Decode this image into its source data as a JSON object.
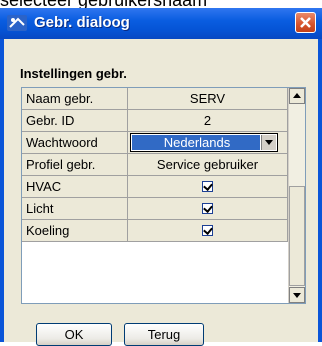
{
  "top_caption": "selecteer gebruikersnaam",
  "window": {
    "title": "Gebr. dialoog"
  },
  "section_title": "Instellingen gebr.",
  "rows": [
    {
      "label": "Naam gebr.",
      "value": "SERV"
    },
    {
      "label": "Gebr. ID",
      "value": "2"
    },
    {
      "label": "Wachtwoord",
      "value": "Nederlands"
    },
    {
      "label": "Profiel gebr.",
      "value": "Service gebruiker"
    },
    {
      "label": "HVAC",
      "checked": true
    },
    {
      "label": "Licht",
      "checked": true
    },
    {
      "label": "Koeling",
      "checked": true
    }
  ],
  "buttons": {
    "ok": "OK",
    "back": "Terug"
  }
}
